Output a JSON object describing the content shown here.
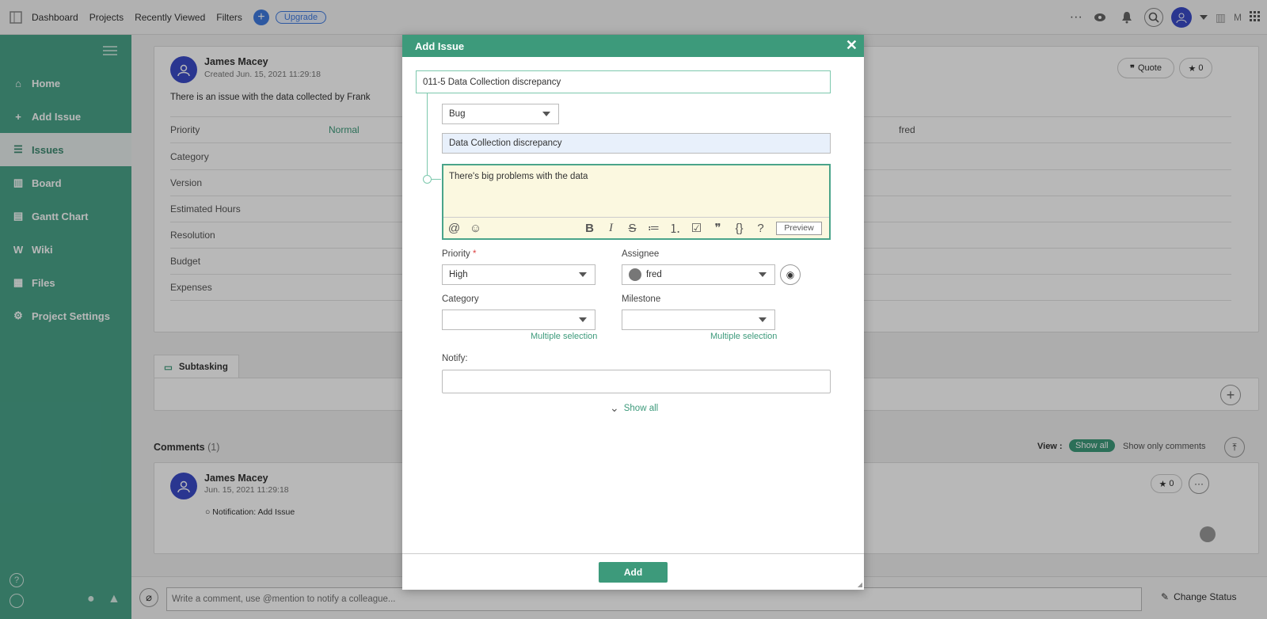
{
  "topbar": {
    "nav": [
      "Dashboard",
      "Projects",
      "Recently Viewed",
      "Filters"
    ],
    "upgrade": "Upgrade",
    "more": "···",
    "user_initial": "M"
  },
  "sidebar": {
    "items": [
      {
        "label": "Home",
        "icon": "home-icon"
      },
      {
        "label": "Add Issue",
        "icon": "plus-icon"
      },
      {
        "label": "Issues",
        "icon": "list-icon"
      },
      {
        "label": "Board",
        "icon": "board-icon"
      },
      {
        "label": "Gantt Chart",
        "icon": "gantt-icon"
      },
      {
        "label": "Wiki",
        "icon": "wiki-icon"
      },
      {
        "label": "Files",
        "icon": "files-icon"
      },
      {
        "label": "Project Settings",
        "icon": "gear-icon"
      }
    ]
  },
  "issue": {
    "author": "James Macey",
    "created": "Created  Jun. 15, 2021 11:29:18",
    "description": "There is an issue with the data collected by Frank",
    "quote": "Quote",
    "stars": "0",
    "priority_label": "Priority",
    "priority_value": "Normal",
    "assignee_value": "fred",
    "fields": [
      "Category",
      "Version",
      "Estimated Hours",
      "Resolution",
      "Budget",
      "Expenses"
    ]
  },
  "subtasking": {
    "label": "Subtasking"
  },
  "comments": {
    "label": "Comments",
    "count": "(1)",
    "view_label": "View :",
    "show_all": "Show all",
    "show_only": "Show only comments",
    "author": "James Macey",
    "date": "Jun. 15, 2021 11:29:18",
    "notification": "Notification: Add Issue",
    "stars": "0"
  },
  "footer": {
    "comment_placeholder": "Write a comment, use @mention to notify a colleague...",
    "change_status": "Change Status"
  },
  "modal": {
    "title": "Add Issue",
    "parent_issue": "011-5 Data Collection discrepancy",
    "issue_type": "Bug",
    "summary": "Data Collection discrepancy",
    "description": "There's big problems with the data",
    "preview": "Preview",
    "priority_label": "Priority",
    "required_mark": "*",
    "priority_value": "High",
    "assignee_label": "Assignee",
    "assignee_value": "fred",
    "category_label": "Category",
    "milestone_label": "Milestone",
    "multiple_selection": "Multiple selection",
    "notify_label": "Notify:",
    "show_all": "Show all",
    "add_button": "Add"
  },
  "colors": {
    "brand": "#4aa48a",
    "header": "#3d9a7b",
    "accent": "#3f7be0"
  }
}
